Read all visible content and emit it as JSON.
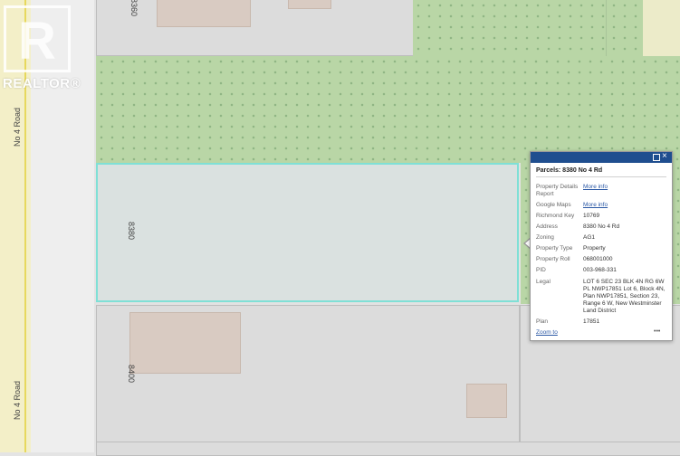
{
  "watermark": {
    "text": "REALTOR®"
  },
  "road": {
    "label_top": "No 4 Road",
    "label_bottom": "No 4 Road"
  },
  "parcels": {
    "top_address": "8360",
    "selected_address": "8380",
    "bottom_address": "8400"
  },
  "popup": {
    "title": "Parcels: 8380 No 4 Rd",
    "rows": [
      {
        "label": "Property Details Report",
        "value": "More info",
        "link": true
      },
      {
        "label": "Google Maps",
        "value": "More info",
        "link": true
      },
      {
        "label": "Richmond Key",
        "value": "10769",
        "link": false
      },
      {
        "label": "Address",
        "value": "8380 No 4 Rd",
        "link": false
      },
      {
        "label": "Zoning",
        "value": "AG1",
        "link": false
      },
      {
        "label": "Property Type",
        "value": "Property",
        "link": false
      },
      {
        "label": "Property Roll",
        "value": "068001000",
        "link": false
      },
      {
        "label": "PID",
        "value": "003-968-331",
        "link": false
      },
      {
        "label": "Legal",
        "value": "LOT 6 SEC 23 BLK 4N RG 6W PL NWP17851 Lot 6, Block 4N, Plan NWP17851, Section 23, Range 6 W, New Westminster Land District",
        "link": false
      },
      {
        "label": "Plan",
        "value": "17851",
        "link": false
      }
    ],
    "zoom_label": "Zoom to",
    "more_label": "•••"
  },
  "colors": {
    "popup_header": "#1f4e8f",
    "selection": "#7fe0d6",
    "green_area": "#b9d6a6"
  }
}
